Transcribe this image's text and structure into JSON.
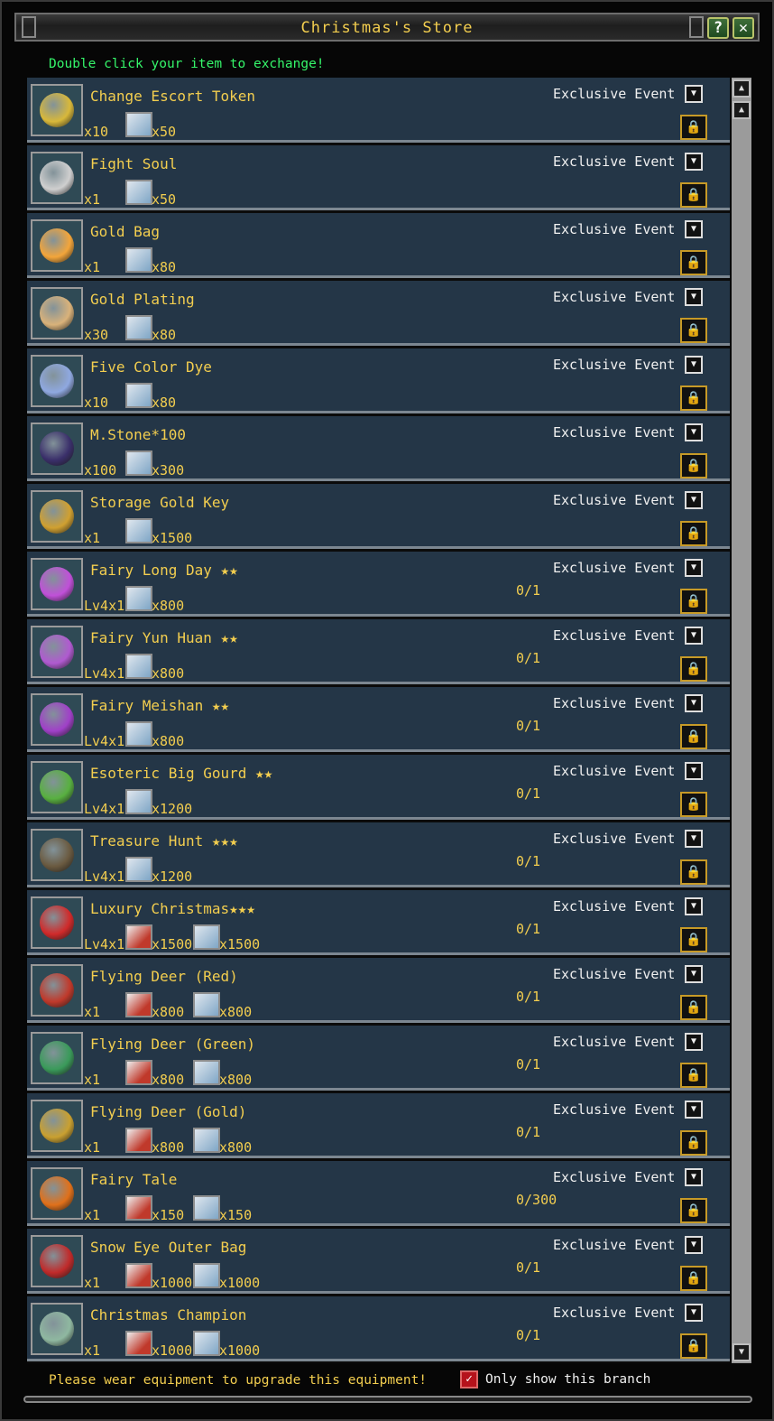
{
  "window": {
    "title": "Christmas's Store",
    "help_label": "?",
    "close_label": "✕",
    "hint": "Double click your item to exchange!"
  },
  "items": [
    {
      "name": "Change Escort Token",
      "qty": "x10",
      "limit": "",
      "costs": [
        {
          "type": "blue",
          "amount": "x50"
        }
      ],
      "tag": "Exclusive Event",
      "color": "#d8b83a"
    },
    {
      "name": "Fight Soul",
      "qty": "x1",
      "limit": "",
      "costs": [
        {
          "type": "blue",
          "amount": "x50"
        }
      ],
      "tag": "Exclusive Event",
      "color": "#cfcfcf"
    },
    {
      "name": "Gold Bag",
      "qty": "x1",
      "limit": "",
      "costs": [
        {
          "type": "blue",
          "amount": "x80"
        }
      ],
      "tag": "Exclusive Event",
      "color": "#f3a53a"
    },
    {
      "name": "Gold Plating",
      "qty": "x30",
      "limit": "",
      "costs": [
        {
          "type": "blue",
          "amount": "x80"
        }
      ],
      "tag": "Exclusive Event",
      "color": "#d9b27a"
    },
    {
      "name": "Five Color Dye",
      "qty": "x10",
      "limit": "",
      "costs": [
        {
          "type": "blue",
          "amount": "x80"
        }
      ],
      "tag": "Exclusive Event",
      "color": "#8fa8e0"
    },
    {
      "name": "M.Stone*100",
      "qty": "x100",
      "limit": "",
      "costs": [
        {
          "type": "blue",
          "amount": "x300"
        }
      ],
      "tag": "Exclusive Event",
      "color": "#3a2f6a"
    },
    {
      "name": "Storage Gold Key",
      "qty": "x1",
      "limit": "",
      "costs": [
        {
          "type": "blue",
          "amount": "x1500"
        }
      ],
      "tag": "Exclusive Event",
      "color": "#d0a030"
    },
    {
      "name": "Fairy Long Day ★★",
      "qty": "Lv4x1",
      "limit": "0/1",
      "costs": [
        {
          "type": "blue",
          "amount": "x800"
        }
      ],
      "tag": "Exclusive Event",
      "color": "#c050d8"
    },
    {
      "name": "Fairy Yun Huan ★★",
      "qty": "Lv4x1",
      "limit": "0/1",
      "costs": [
        {
          "type": "blue",
          "amount": "x800"
        }
      ],
      "tag": "Exclusive Event",
      "color": "#b05ad0"
    },
    {
      "name": "Fairy Meishan ★★",
      "qty": "Lv4x1",
      "limit": "0/1",
      "costs": [
        {
          "type": "blue",
          "amount": "x800"
        }
      ],
      "tag": "Exclusive Event",
      "color": "#a040c8"
    },
    {
      "name": "Esoteric Big Gourd ★★",
      "qty": "Lv4x1",
      "limit": "0/1",
      "costs": [
        {
          "type": "blue",
          "amount": "x1200"
        }
      ],
      "tag": "Exclusive Event",
      "color": "#58b040"
    },
    {
      "name": "Treasure Hunt ★★★",
      "qty": "Lv4x1",
      "limit": "0/1",
      "costs": [
        {
          "type": "blue",
          "amount": "x1200"
        }
      ],
      "tag": "Exclusive Event",
      "color": "#6a5a40"
    },
    {
      "name": "Luxury Christmas★★★",
      "qty": "Lv4x1",
      "limit": "0/1",
      "costs": [
        {
          "type": "red",
          "amount": "x1500"
        },
        {
          "type": "blue",
          "amount": "x1500"
        }
      ],
      "tag": "Exclusive Event",
      "color": "#d02a2a"
    },
    {
      "name": "Flying Deer (Red)",
      "qty": "x1",
      "limit": "0/1",
      "costs": [
        {
          "type": "red",
          "amount": "x800"
        },
        {
          "type": "blue",
          "amount": "x800"
        }
      ],
      "tag": "Exclusive Event",
      "color": "#c0392b"
    },
    {
      "name": "Flying Deer (Green)",
      "qty": "x1",
      "limit": "0/1",
      "costs": [
        {
          "type": "red",
          "amount": "x800"
        },
        {
          "type": "blue",
          "amount": "x800"
        }
      ],
      "tag": "Exclusive Event",
      "color": "#3a9a5a"
    },
    {
      "name": "Flying Deer (Gold)",
      "qty": "x1",
      "limit": "0/1",
      "costs": [
        {
          "type": "red",
          "amount": "x800"
        },
        {
          "type": "blue",
          "amount": "x800"
        }
      ],
      "tag": "Exclusive Event",
      "color": "#c9a030"
    },
    {
      "name": "Fairy Tale",
      "qty": "x1",
      "limit": "0/300",
      "costs": [
        {
          "type": "red",
          "amount": "x150"
        },
        {
          "type": "blue",
          "amount": "x150"
        }
      ],
      "tag": "Exclusive Event",
      "color": "#e0701a"
    },
    {
      "name": "Snow Eye Outer Bag",
      "qty": "x1",
      "limit": "0/1",
      "costs": [
        {
          "type": "red",
          "amount": "x1000"
        },
        {
          "type": "blue",
          "amount": "x1000"
        }
      ],
      "tag": "Exclusive Event",
      "color": "#c02a2a"
    },
    {
      "name": "Christmas     Champion",
      "qty": "x1",
      "limit": "0/1",
      "costs": [
        {
          "type": "red",
          "amount": "x1000"
        },
        {
          "type": "blue",
          "amount": "x1000"
        }
      ],
      "tag": "Exclusive Event",
      "color": "#8fb8a0"
    }
  ],
  "footer": {
    "message": "Please wear equipment to upgrade this equipment!",
    "checkbox_label": "Only show this branch",
    "checkbox_checked": true
  },
  "icons": {
    "dropdown": "chevron-down-icon",
    "lock": "lock-icon",
    "scroll_up": "scroll-up-icon",
    "scroll_down": "scroll-down-icon"
  }
}
